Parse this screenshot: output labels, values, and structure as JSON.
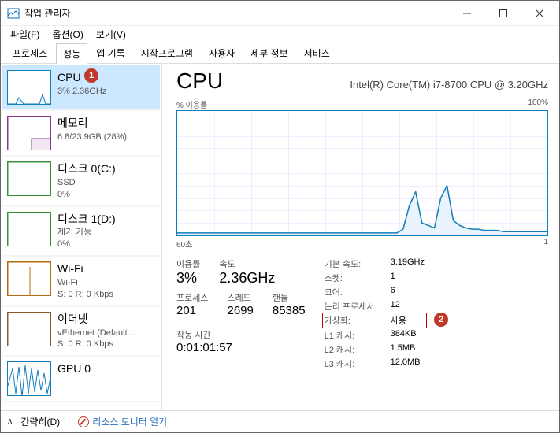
{
  "window": {
    "title": "작업 관리자"
  },
  "menu": {
    "file": "파일(F)",
    "option": "옵션(O)",
    "view": "보기(V)"
  },
  "tabs": {
    "processes": "프로세스",
    "performance": "성능",
    "apphistory": "앱 기록",
    "startup": "시작프로그램",
    "users": "사용자",
    "details": "세부 정보",
    "services": "서비스"
  },
  "sidebar": [
    {
      "title": "CPU",
      "sub": "3% 2.36GHz",
      "color": "#117dbb",
      "active": true,
      "mini": "cpu"
    },
    {
      "title": "메모리",
      "sub": "6.8/23.9GB (28%)",
      "color": "#8b3a8b",
      "active": false,
      "mini": "mem"
    },
    {
      "title": "디스크 0(C:)",
      "sub": "SSD",
      "sub2": "0%",
      "color": "#3a923a",
      "active": false,
      "mini": "disk"
    },
    {
      "title": "디스크 1(D:)",
      "sub": "제거 가능",
      "sub2": "0%",
      "color": "#3a923a",
      "active": false,
      "mini": "disk"
    },
    {
      "title": "Wi-Fi",
      "sub": "Wi-Fi",
      "sub2": "S: 0  R: 0 Kbps",
      "color": "#b56a17",
      "active": false,
      "mini": "wifi"
    },
    {
      "title": "이더넷",
      "sub": "vEthernet (Default...",
      "sub2": "S: 0  R: 0 Kbps",
      "color": "#8a5a2b",
      "active": false,
      "mini": "eth"
    },
    {
      "title": "GPU 0",
      "sub": "",
      "color": "#117dbb",
      "active": false,
      "mini": "gpu"
    }
  ],
  "detail": {
    "title": "CPU",
    "model": "Intel(R) Core(TM) i7-8700 CPU @ 3.20GHz",
    "graph_top_l": "% 이용률",
    "graph_top_r": "100%",
    "graph_bot_l": "60초",
    "graph_bot_r": "1",
    "labels": {
      "util": "이용률",
      "speed": "속도",
      "procs": "프로세스",
      "threads": "스레드",
      "handles": "핸들",
      "uptime": "작동 시간"
    },
    "values": {
      "util": "3%",
      "speed": "2.36GHz",
      "procs": "201",
      "threads": "2699",
      "handles": "85385",
      "uptime": "0:01:01:57"
    },
    "kv": [
      {
        "k": "기본 속도:",
        "v": "3.19GHz"
      },
      {
        "k": "소켓:",
        "v": "1"
      },
      {
        "k": "코어:",
        "v": "6"
      },
      {
        "k": "논리 프로세서:",
        "v": "12"
      },
      {
        "k": "가상화:",
        "v": "사용",
        "hl": true
      },
      {
        "k": "L1 캐시:",
        "v": "384KB"
      },
      {
        "k": "L2 캐시:",
        "v": "1.5MB"
      },
      {
        "k": "L3 캐시:",
        "v": "12.0MB"
      }
    ]
  },
  "footer": {
    "less": "간략히(D)",
    "resmon": "리소스 모니터 열기"
  },
  "badges": {
    "one": "1",
    "two": "2"
  },
  "chart_data": {
    "type": "line",
    "title": "CPU % 이용률",
    "xlabel": "60초 → 1",
    "ylabel": "% 이용률",
    "ylim": [
      0,
      100
    ],
    "x": [
      60,
      55,
      50,
      45,
      40,
      35,
      30,
      25,
      24,
      23,
      22,
      21,
      20,
      19,
      18,
      17,
      16,
      15,
      14,
      13,
      12,
      11,
      10,
      9,
      8,
      7,
      6,
      5,
      4,
      3,
      2,
      1
    ],
    "values": [
      2,
      2,
      2,
      2,
      2,
      2,
      2,
      2,
      5,
      24,
      35,
      10,
      8,
      6,
      30,
      40,
      12,
      8,
      6,
      5,
      5,
      4,
      4,
      4,
      3,
      3,
      3,
      3,
      3,
      3,
      3,
      3
    ]
  }
}
